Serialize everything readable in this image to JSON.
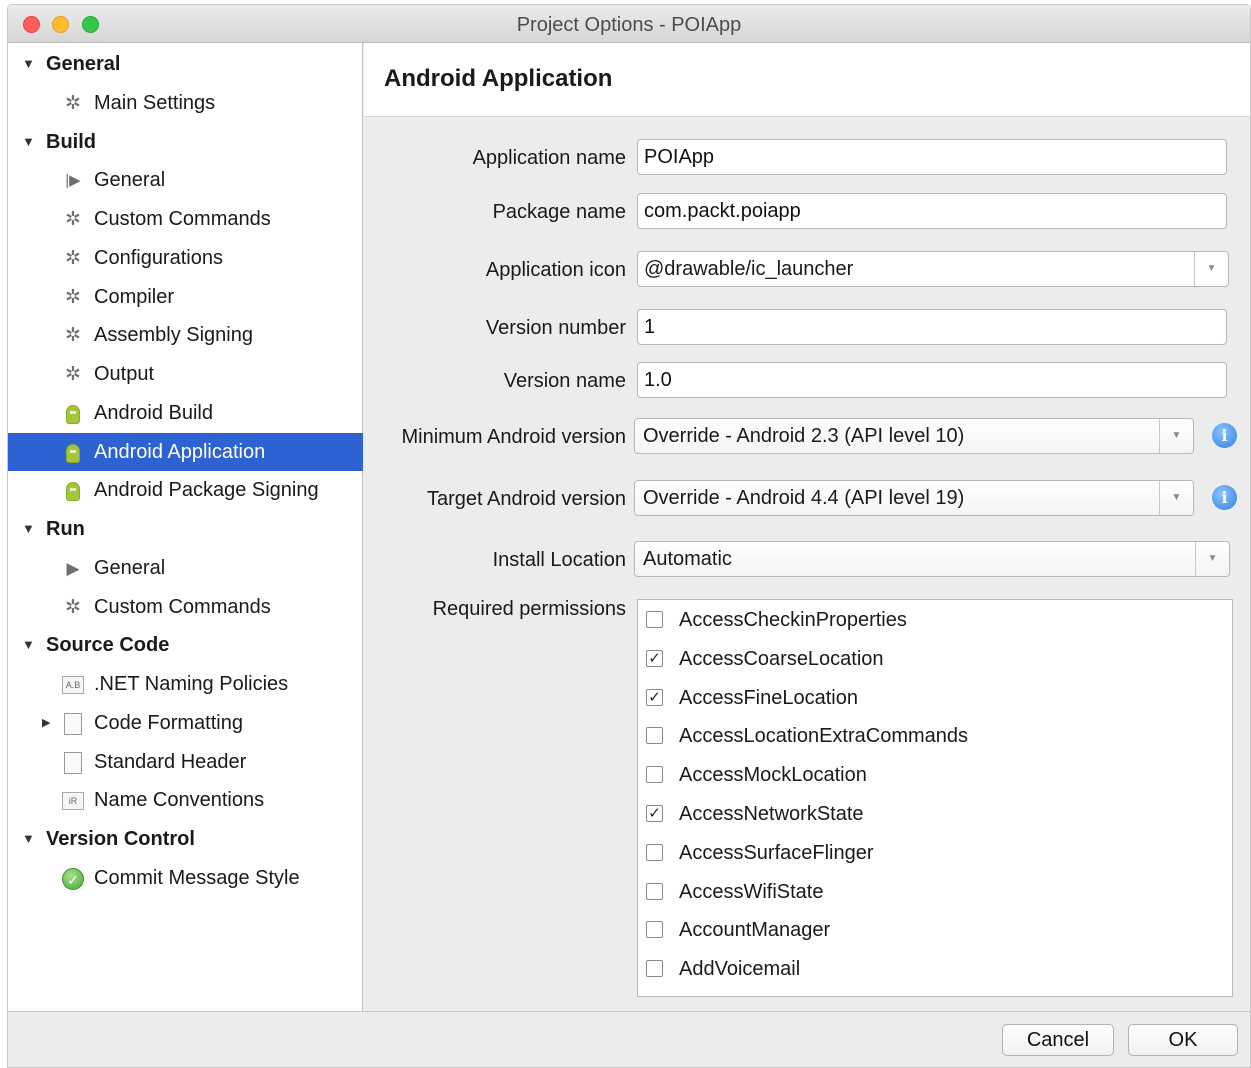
{
  "window": {
    "title": "Project Options - POIApp"
  },
  "sidebar": {
    "sections": [
      {
        "label": "General",
        "items": [
          {
            "label": "Main Settings",
            "icon": "gear-icon"
          }
        ]
      },
      {
        "label": "Build",
        "items": [
          {
            "label": "General",
            "icon": "build-icon"
          },
          {
            "label": "Custom Commands",
            "icon": "gear-icon"
          },
          {
            "label": "Configurations",
            "icon": "gear-icon"
          },
          {
            "label": "Compiler",
            "icon": "gear-icon"
          },
          {
            "label": "Assembly Signing",
            "icon": "gear-icon"
          },
          {
            "label": "Output",
            "icon": "gear-icon"
          },
          {
            "label": "Android Build",
            "icon": "android-icon"
          },
          {
            "label": "Android Application",
            "icon": "android-icon",
            "selected": true
          },
          {
            "label": "Android Package Signing",
            "icon": "android-icon"
          }
        ]
      },
      {
        "label": "Run",
        "items": [
          {
            "label": "General",
            "icon": "play-icon"
          },
          {
            "label": "Custom Commands",
            "icon": "gear-icon"
          }
        ]
      },
      {
        "label": "Source Code",
        "items": [
          {
            "label": ".NET Naming Policies",
            "icon": "naming-policy-icon",
            "icon_text": "A.B"
          },
          {
            "label": "Code Formatting",
            "icon": "document-icon",
            "collapsed": true
          },
          {
            "label": "Standard Header",
            "icon": "document-icon"
          },
          {
            "label": "Name Conventions",
            "icon": "name-convention-icon",
            "icon_text": "iR"
          }
        ]
      },
      {
        "label": "Version Control",
        "items": [
          {
            "label": "Commit Message Style",
            "icon": "green-check-icon"
          }
        ]
      }
    ]
  },
  "page": {
    "title": "Android Application",
    "fields": {
      "app_name": {
        "label": "Application name",
        "value": "POIApp"
      },
      "package_name": {
        "label": "Package name",
        "value": "com.packt.poiapp"
      },
      "app_icon": {
        "label": "Application icon",
        "value": "@drawable/ic_launcher"
      },
      "version_number": {
        "label": "Version number",
        "value": "1"
      },
      "version_name": {
        "label": "Version name",
        "value": "1.0"
      },
      "min_android": {
        "label": "Minimum Android version",
        "value": "Override - Android 2.3 (API level 10)"
      },
      "target_android": {
        "label": "Target Android version",
        "value": "Override - Android 4.4 (API level 19)"
      },
      "install_location": {
        "label": "Install Location",
        "value": "Automatic"
      }
    },
    "permissions": {
      "label": "Required permissions",
      "items": [
        {
          "name": "AccessCheckinProperties",
          "checked": false
        },
        {
          "name": "AccessCoarseLocation",
          "checked": true
        },
        {
          "name": "AccessFineLocation",
          "checked": true
        },
        {
          "name": "AccessLocationExtraCommands",
          "checked": false
        },
        {
          "name": "AccessMockLocation",
          "checked": false
        },
        {
          "name": "AccessNetworkState",
          "checked": true
        },
        {
          "name": "AccessSurfaceFlinger",
          "checked": false
        },
        {
          "name": "AccessWifiState",
          "checked": false
        },
        {
          "name": "AccountManager",
          "checked": false
        },
        {
          "name": "AddVoicemail",
          "checked": false
        }
      ]
    }
  },
  "footer": {
    "cancel_label": "Cancel",
    "ok_label": "OK"
  },
  "colors": {
    "selection": "#2d62d2",
    "android": "#a4c639",
    "info": "#2f7fe0"
  },
  "glyphs": {
    "gear": "✲",
    "play": "▶",
    "build": "|▶",
    "check": "✓",
    "expanded": "▼",
    "collapsed": "▶",
    "dropdown": "▼",
    "info": "i"
  }
}
